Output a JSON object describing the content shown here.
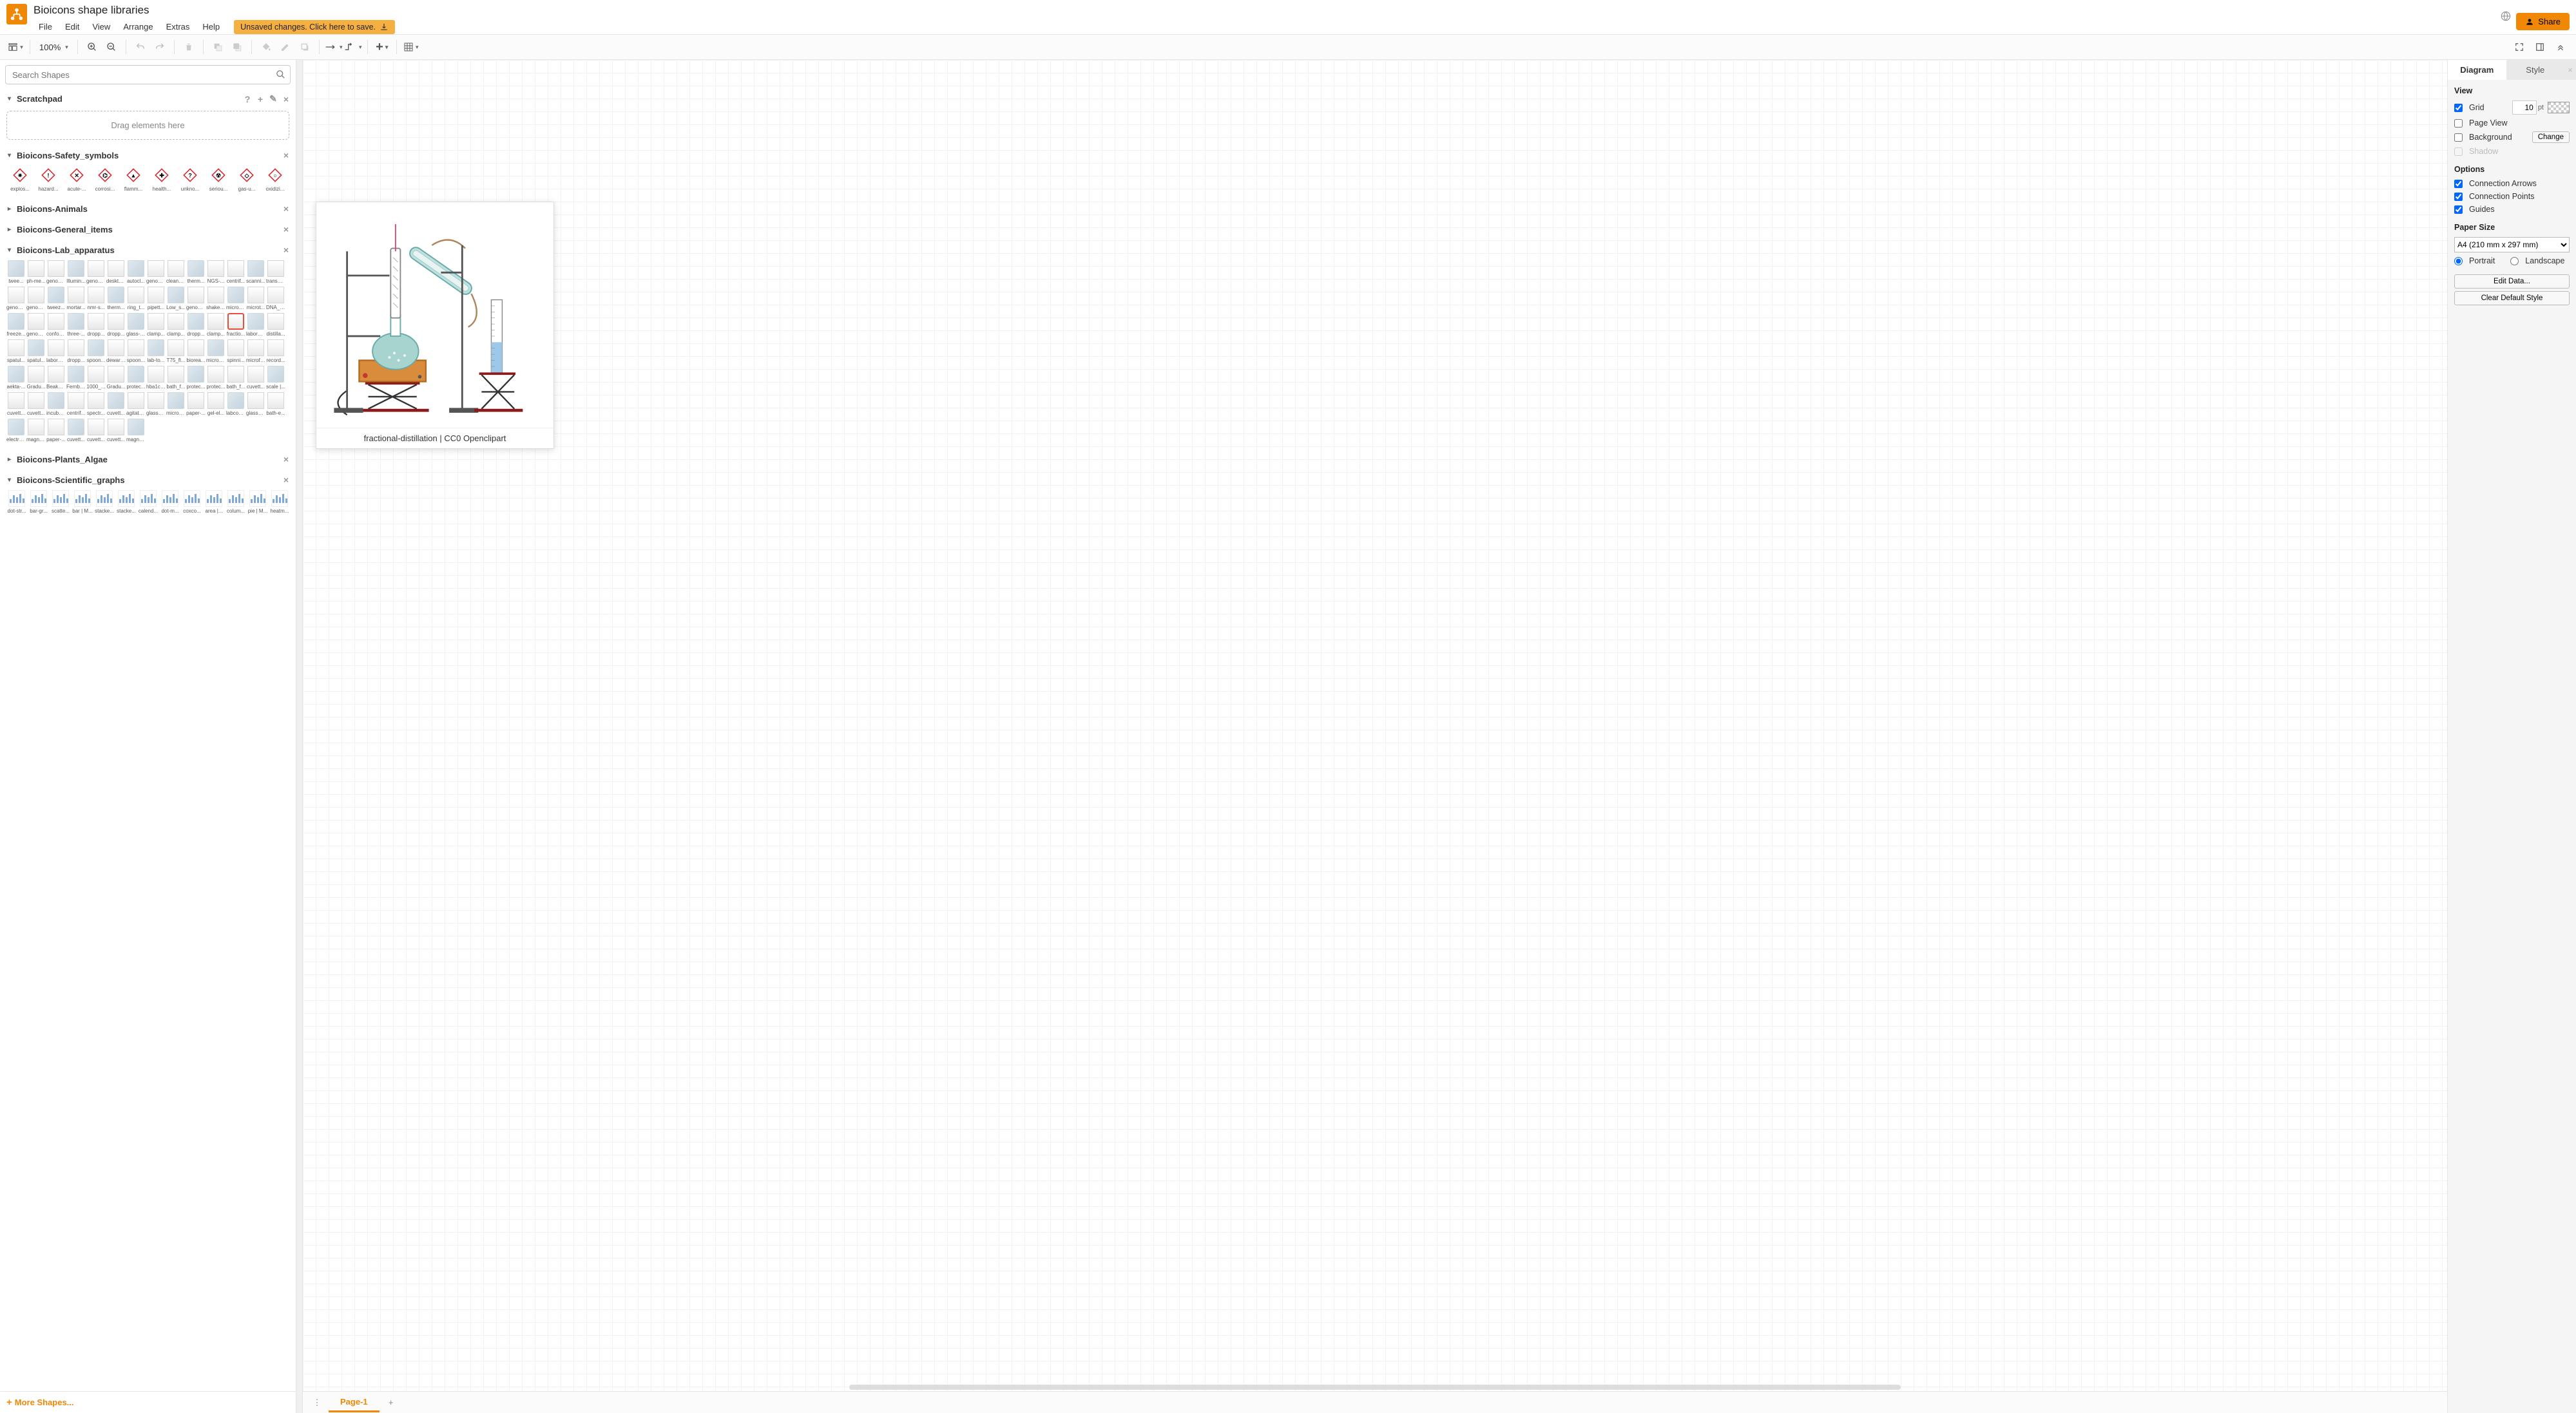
{
  "header": {
    "doc_title": "Bioicons shape libraries",
    "menu": [
      "File",
      "Edit",
      "View",
      "Arrange",
      "Extras",
      "Help"
    ],
    "save_banner": "Unsaved changes. Click here to save.",
    "share_label": "Share"
  },
  "toolbar": {
    "zoom_value": "100%"
  },
  "sidebar": {
    "search_placeholder": "Search Shapes",
    "scratchpad_title": "Scratchpad",
    "scratchpad_drop": "Drag elements here",
    "more_shapes": "More Shapes...",
    "sections": {
      "safety": {
        "title": "Bioicons-Safety_symbols",
        "items": [
          "explos...",
          "hazard...",
          "acute-...",
          "corrosi...",
          "flamm...",
          "health...",
          "unkno...",
          "seriou...",
          "gas-u...",
          "oxidizi..."
        ]
      },
      "animals": {
        "title": "Bioicons-Animals"
      },
      "general": {
        "title": "Bioicons-General_items"
      },
      "lab": {
        "title": "Bioicons-Lab_apparatus",
        "rows": [
          [
            "twee...",
            "ph-me...",
            "genom...",
            "Illumin...",
            "genom...",
            "deskto...",
            "autocl...",
            "genom...",
            "cleanb...",
            "therm...",
            "NGS-...",
            "centrif...",
            "scanni...",
            "transm..."
          ],
          [
            "genom...",
            "genom...",
            "tweez...",
            "mortar...",
            "nmr-s...",
            "therm...",
            "ring_t...",
            "pipett...",
            "Low_s...",
            "genom...",
            "shaker...",
            "micros...",
            "microt...",
            ""
          ],
          [
            "DNA_s...",
            "freeze...",
            "genom...",
            "confoc...",
            "three-...",
            "dropp...",
            "dropp...",
            "glass-r...",
            "clamp...",
            "clamp...",
            "dropp...",
            "clamp...",
            "fractio...",
            ""
          ],
          [
            "laborat...",
            "distilla...",
            "spatul...",
            "spatul...",
            "laborat...",
            "dropp...",
            "spoon...",
            "dewar-...",
            "spoon...",
            "lab-to...",
            "T75_fl...",
            "biorea...",
            "micro_...",
            "spinni..."
          ],
          [
            "microfl...",
            "record...",
            "aekta-...",
            "Gradu...",
            "Beaker...",
            "Fernba...",
            "1000_...",
            "Gradu...",
            "protec...",
            "hba1ca...",
            "bath_f...",
            "protec...",
            "protec...",
            "bath_f..."
          ],
          [
            "cuvett...",
            "scale |...",
            "cuvett...",
            "cuvett...",
            "incuba...",
            "centrif...",
            "spectr...",
            "cuvett...",
            "agitato...",
            "glassSl...",
            "micros...",
            "paper-...",
            "gel-el...",
            ""
          ],
          [
            "labcoa...",
            "glassSl...",
            "bath-e...",
            "electro...",
            "magne...",
            "paper-...",
            "cuvett...",
            "cuvett...",
            "cuvett...",
            "magne...",
            "",
            "",
            "",
            ""
          ]
        ],
        "selected": {
          "row": 2,
          "col": 12
        }
      },
      "plants": {
        "title": "Bioicons-Plants_Algae"
      },
      "graphs": {
        "title": "Bioicons-Scientific_graphs",
        "items": [
          "dot-str...",
          "bar-gr...",
          "scatte...",
          "bar | M...",
          "stacke...",
          "stacke...",
          "calend...",
          "dot-m...",
          "coxco...",
          "area |...",
          "colum...",
          "pie | M...",
          "heatm..."
        ]
      }
    }
  },
  "canvas": {
    "preview_caption": "fractional-distillation | CC0 Openclipart"
  },
  "footer": {
    "page_tab": "Page-1"
  },
  "format": {
    "tabs": {
      "diagram": "Diagram",
      "style": "Style"
    },
    "view_title": "View",
    "grid_label": "Grid",
    "grid_value": "10",
    "grid_unit": "pt",
    "pageview_label": "Page View",
    "background_label": "Background",
    "change_label": "Change",
    "shadow_label": "Shadow",
    "options_title": "Options",
    "conn_arrows": "Connection Arrows",
    "conn_points": "Connection Points",
    "guides": "Guides",
    "paper_title": "Paper Size",
    "paper_value": "A4 (210 mm x 297 mm)",
    "portrait": "Portrait",
    "landscape": "Landscape",
    "edit_data": "Edit Data...",
    "clear_style": "Clear Default Style"
  }
}
